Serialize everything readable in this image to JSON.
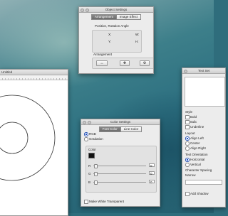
{
  "untitled": {
    "title": "Untitled"
  },
  "object_settings": {
    "title": "Object Settings",
    "tabs": [
      {
        "label": "Arrangement"
      },
      {
        "label": "Image Effect"
      }
    ],
    "position_label": "Position, Rotation Angle",
    "x_label": "X:",
    "w_label": "W:",
    "y_label": "Y:",
    "h_label": "H:",
    "arrangement_label": "Arrangement"
  },
  "color_settings": {
    "title": "Color Settings",
    "tabs": [
      {
        "label": "Font Color"
      },
      {
        "label": "Line Color"
      }
    ],
    "rgb_label": "RGB",
    "gradation_label": "Gradation",
    "color_label": "Color",
    "channels": [
      {
        "label": "R",
        "value": "0"
      },
      {
        "label": "G",
        "value": "0"
      },
      {
        "label": "B",
        "value": "0"
      }
    ],
    "transparent_label": "Make White Transparent",
    "swatch_color": "#111111"
  },
  "text_settings": {
    "title": "Text Set",
    "style_label": "Style",
    "styles": [
      {
        "label": "Bold"
      },
      {
        "label": "Italic"
      },
      {
        "label": "Underline"
      }
    ],
    "layout_label": "Layout",
    "layouts": [
      {
        "label": "Align Left",
        "on": true
      },
      {
        "label": "Center",
        "on": false
      },
      {
        "label": "Align Right",
        "on": false
      }
    ],
    "orientation_label": "Text Orientation",
    "orientations": [
      {
        "label": "Horizontal",
        "on": true
      },
      {
        "label": "Vertical",
        "on": false
      }
    ],
    "spacing_label": "Character Spacing",
    "spacing_value": "Narrow",
    "shadow_label": "Add Shadow"
  }
}
